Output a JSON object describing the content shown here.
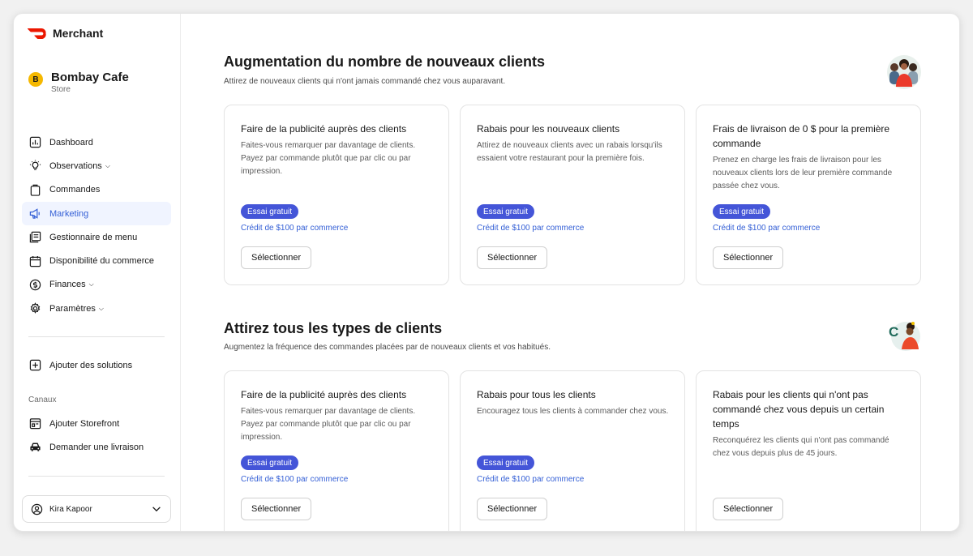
{
  "brand": {
    "name": "Merchant",
    "color": "#eb1700"
  },
  "store": {
    "badge": "B",
    "name": "Bombay Cafe",
    "type": "Store"
  },
  "nav": [
    {
      "label": "Dashboard",
      "icon": "dashboard-icon",
      "dropdown": false,
      "active": false
    },
    {
      "label": "Observations",
      "icon": "lightbulb-icon",
      "dropdown": true,
      "active": false
    },
    {
      "label": "Commandes",
      "icon": "clipboard-icon",
      "dropdown": false,
      "active": false
    },
    {
      "label": "Marketing",
      "icon": "megaphone-icon",
      "dropdown": false,
      "active": true
    },
    {
      "label": "Gestionnaire de menu",
      "icon": "menu-book-icon",
      "dropdown": false,
      "active": false
    },
    {
      "label": "Disponibilité du commerce",
      "icon": "calendar-icon",
      "dropdown": false,
      "active": false
    },
    {
      "label": "Finances",
      "icon": "dollar-icon",
      "dropdown": true,
      "active": false
    },
    {
      "label": "Paramètres",
      "icon": "gear-icon",
      "dropdown": true,
      "active": false
    }
  ],
  "add_solutions": "Ajouter des solutions",
  "channels": {
    "label": "Canaux",
    "items": [
      {
        "label": "Ajouter Storefront",
        "icon": "storefront-icon"
      },
      {
        "label": "Demander une livraison",
        "icon": "car-icon"
      }
    ]
  },
  "user": {
    "name": "Kira Kapoor"
  },
  "sections": [
    {
      "title": "Augmentation du nombre de nouveaux clients",
      "subtitle": "Attirez de nouveaux clients qui n'ont jamais commandé chez vous auparavant.",
      "cards": [
        {
          "title": "Faire de la publicité auprès des clients",
          "desc": "Faites-vous remarquer par davantage de clients. Payez par commande plutôt que par clic ou par impression.",
          "badge": "Essai gratuit",
          "credit": "Crédit de $100 par commerce",
          "button": "Sélectionner"
        },
        {
          "title": "Rabais pour les nouveaux clients",
          "desc": "Attirez de nouveaux clients avec un rabais lorsqu'ils essaient votre restaurant pour la première fois.",
          "badge": "Essai gratuit",
          "credit": "Crédit de $100 par commerce",
          "button": "Sélectionner"
        },
        {
          "title": "Frais de livraison de 0 $ pour la première commande",
          "desc": "Prenez en charge les frais de livraison pour les nouveaux clients lors de leur première commande passée chez vous.",
          "badge": "Essai gratuit",
          "credit": "Crédit de $100 par commerce",
          "button": "Sélectionner"
        }
      ]
    },
    {
      "title": "Attirez tous les types de clients",
      "subtitle": "Augmentez la fréquence des commandes placées par de nouveaux clients et vos habitués.",
      "cards": [
        {
          "title": "Faire de la publicité auprès des clients",
          "desc": "Faites-vous remarquer par davantage de clients. Payez par commande plutôt que par clic ou par impression.",
          "badge": "Essai gratuit",
          "credit": "Crédit de $100 par commerce",
          "button": "Sélectionner"
        },
        {
          "title": "Rabais pour tous les clients",
          "desc": "Encouragez tous les clients à commander chez vous.",
          "badge": "Essai gratuit",
          "credit": "Crédit de $100 par commerce",
          "button": "Sélectionner"
        },
        {
          "title": "Rabais pour les clients qui n'ont pas commandé chez vous depuis un certain temps",
          "desc": "Reconquérez les clients qui n'ont pas commandé chez vous depuis plus de 45 jours.",
          "button": "Sélectionner"
        }
      ]
    }
  ],
  "colors": {
    "accent": "#3560d6",
    "badge": "#4455d8",
    "active_bg": "#f0f4ff"
  }
}
